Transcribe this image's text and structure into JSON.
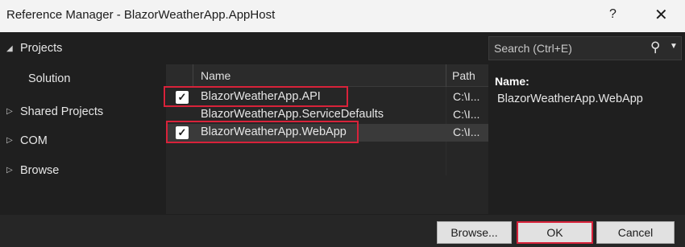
{
  "window": {
    "title": "Reference Manager - BlazorWeatherApp.AppHost",
    "help_label": "?",
    "close_label": "✕"
  },
  "sidebar": {
    "items": [
      {
        "label": "Projects",
        "expanded": true
      },
      {
        "label": "Solution",
        "selected": true
      },
      {
        "label": "Shared Projects",
        "expanded": false
      },
      {
        "label": "COM",
        "expanded": false
      },
      {
        "label": "Browse",
        "expanded": false
      }
    ]
  },
  "search": {
    "placeholder": "Search (Ctrl+E)"
  },
  "list": {
    "columns": [
      "Name",
      "Path"
    ],
    "rows": [
      {
        "checked": true,
        "name": "BlazorWeatherApp.API",
        "path": "C:\\I...",
        "highlighted": true
      },
      {
        "checked": false,
        "name": "BlazorWeatherApp.ServiceDefaults",
        "path": "C:\\I...",
        "highlighted": false
      },
      {
        "checked": true,
        "name": "BlazorWeatherApp.WebApp",
        "path": "C:\\I...",
        "highlighted": true,
        "selected": true
      }
    ]
  },
  "details": {
    "label": "Name:",
    "value": "BlazorWeatherApp.WebApp"
  },
  "buttons": {
    "browse": "Browse...",
    "ok": "OK",
    "cancel": "Cancel"
  },
  "colors": {
    "highlight": "#d8223a",
    "background": "#1f1f1f",
    "list_background": "#262626",
    "title_bar": "#f3f3f3"
  }
}
